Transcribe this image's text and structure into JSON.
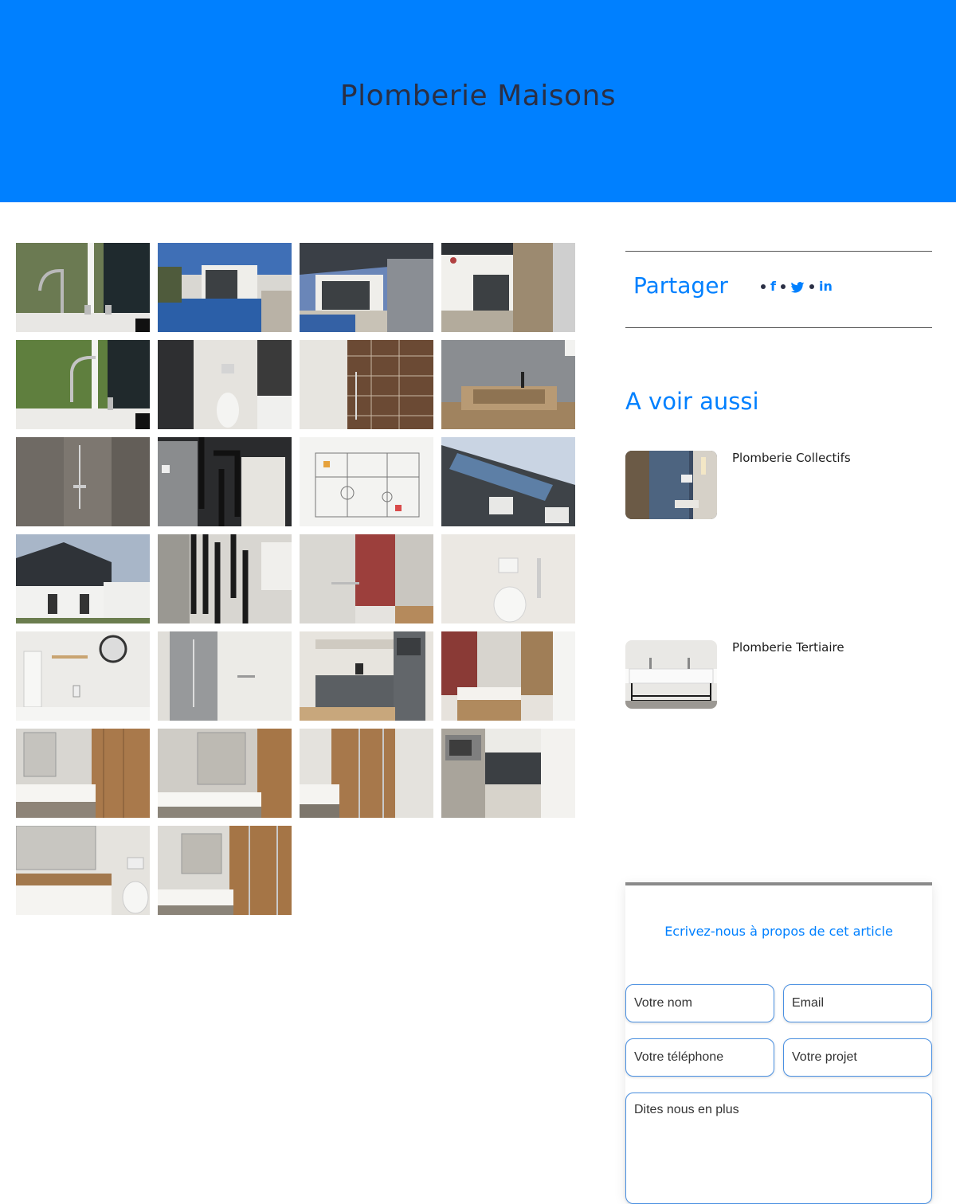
{
  "page": {
    "title": "Plomberie Maisons"
  },
  "colors": {
    "primary": "#0080ff",
    "title_text": "#2a2f45"
  },
  "gallery": {
    "items": [
      {
        "alt": "robinet-cuisine"
      },
      {
        "alt": "piscine-maison"
      },
      {
        "alt": "terrasse-maison"
      },
      {
        "alt": "facade-baie"
      },
      {
        "alt": "robinet-jardin"
      },
      {
        "alt": "wc-suspendu"
      },
      {
        "alt": "douche-faience"
      },
      {
        "alt": "vasque-bois"
      },
      {
        "alt": "douche-gris"
      },
      {
        "alt": "chauffe-eau"
      },
      {
        "alt": "schema-installation"
      },
      {
        "alt": "panneaux-solaires"
      },
      {
        "alt": "maison-toiture-solaire"
      },
      {
        "alt": "chaufferie"
      },
      {
        "alt": "salle-de-bain-rouge"
      },
      {
        "alt": "wc-blanc"
      },
      {
        "alt": "salle-de-bain-miroir"
      },
      {
        "alt": "douche-vitree"
      },
      {
        "alt": "kitchenette"
      },
      {
        "alt": "meuble-vasque"
      },
      {
        "alt": "salle-de-bain-bois-1"
      },
      {
        "alt": "salle-de-bain-bois-2"
      },
      {
        "alt": "douche-bois"
      },
      {
        "alt": "cuisine-micro-ondes"
      },
      {
        "alt": "meuble-miroir"
      },
      {
        "alt": "salle-de-bain-bois-3"
      }
    ]
  },
  "share": {
    "title": "Partager",
    "icons": [
      "facebook-icon",
      "twitter-icon",
      "linkedin-icon"
    ],
    "facebook_glyph": "f",
    "linkedin_glyph": "in"
  },
  "see_also": {
    "title": "A voir aussi",
    "items": [
      {
        "title": "Plomberie Collectifs"
      },
      {
        "title": "Plomberie Tertiaire"
      }
    ]
  },
  "contact": {
    "title": "Ecrivez-nous à propos de cet article",
    "name_placeholder": "Votre nom",
    "email_placeholder": "Email",
    "phone_placeholder": "Votre téléphone",
    "project_placeholder": "Votre projet",
    "message_placeholder": "Dites nous en plus"
  }
}
